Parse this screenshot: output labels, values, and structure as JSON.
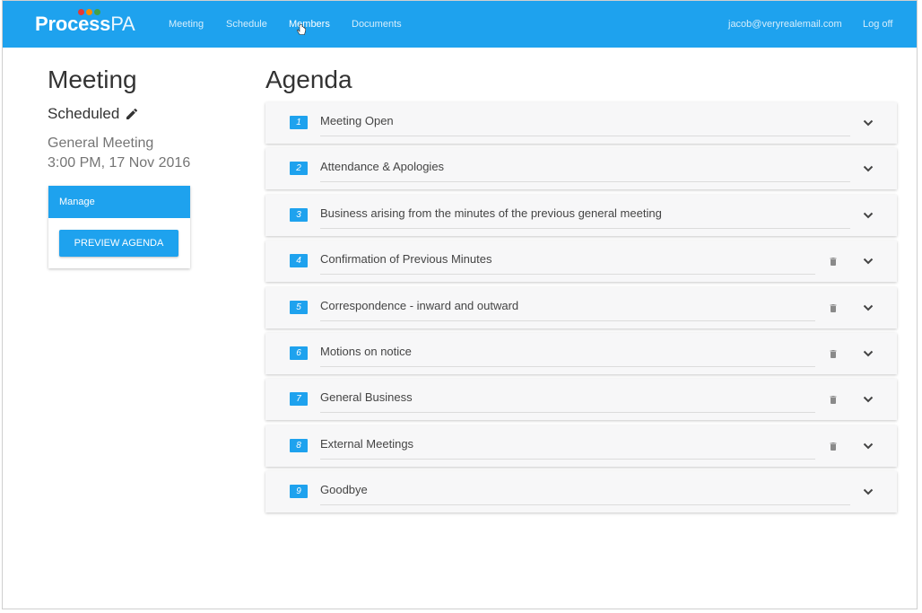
{
  "nav": {
    "logo_bold": "Process",
    "logo_light": "PA",
    "logo_dot_colors": [
      "#e53935",
      "#fb8c00",
      "#43a047"
    ],
    "links": [
      {
        "label": "Meeting"
      },
      {
        "label": "Schedule"
      },
      {
        "label": "Members"
      },
      {
        "label": "Documents"
      }
    ],
    "user_email": "jacob@veryrealemail.com",
    "logoff": "Log off"
  },
  "meeting": {
    "title": "Meeting",
    "status": "Scheduled",
    "type": "General Meeting",
    "datetime": "3:00 PM, 17 Nov 2016"
  },
  "manage": {
    "header": "Manage",
    "preview_button": "PREVIEW AGENDA"
  },
  "agenda": {
    "title": "Agenda",
    "items": [
      {
        "number": "1",
        "label": "Meeting Open",
        "deletable": false
      },
      {
        "number": "2",
        "label": "Attendance & Apologies",
        "deletable": false
      },
      {
        "number": "3",
        "label": "Business arising from the minutes of the previous general meeting",
        "deletable": false
      },
      {
        "number": "4",
        "label": "Confirmation of Previous Minutes",
        "deletable": true
      },
      {
        "number": "5",
        "label": "Correspondence - inward and outward",
        "deletable": true
      },
      {
        "number": "6",
        "label": "Motions on notice",
        "deletable": true
      },
      {
        "number": "7",
        "label": "General Business",
        "deletable": true
      },
      {
        "number": "8",
        "label": "External Meetings",
        "deletable": true
      },
      {
        "number": "9",
        "label": "Goodbye",
        "deletable": false
      }
    ]
  },
  "colors": {
    "accent": "#1ea2ee"
  },
  "icons": {
    "edit": "pencil-icon",
    "delete": "trash-icon",
    "expand": "chevron-down-icon"
  }
}
